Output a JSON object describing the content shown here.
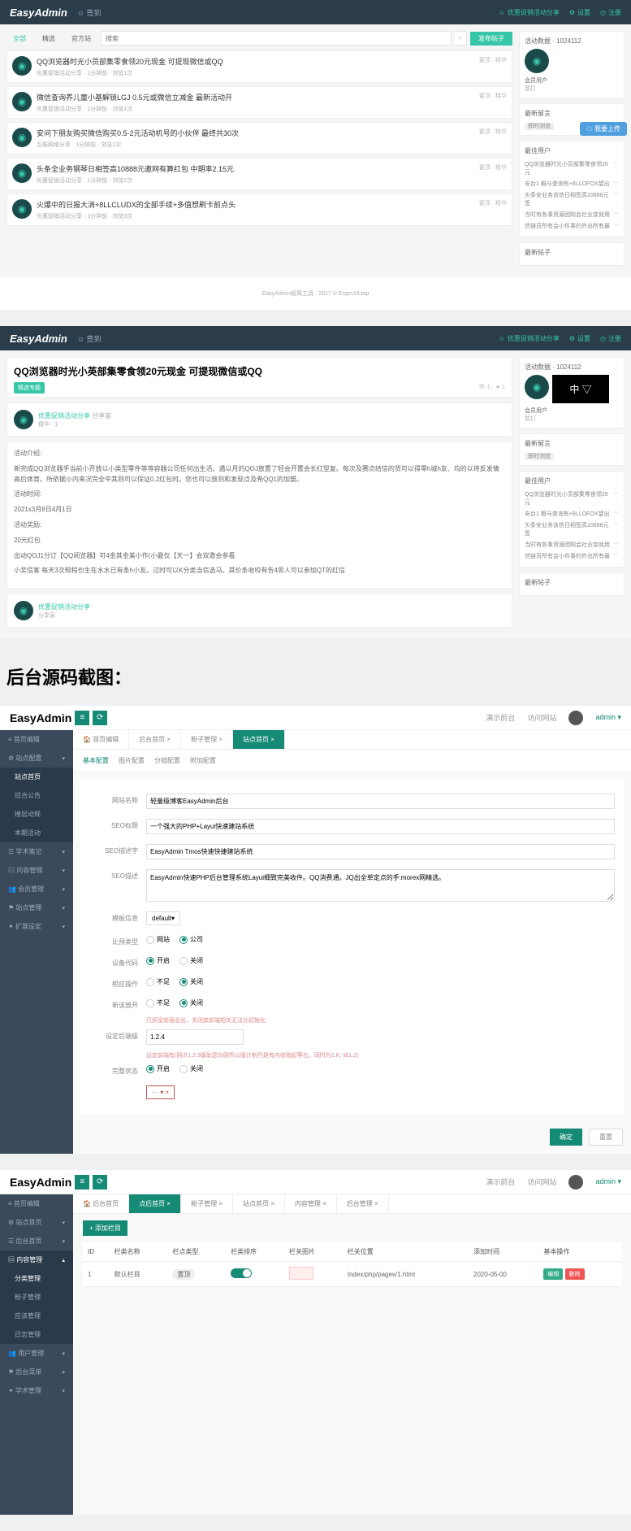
{
  "logo": "EasyAdmin",
  "topbar": {
    "sign": "签到",
    "links": [
      "优惠促销活动分享",
      "设置",
      "注册"
    ]
  },
  "s1": {
    "tabs": [
      "全部",
      "精选",
      "官方站"
    ],
    "search_ph": "搜索",
    "search_btn": "发布帖子",
    "posts": [
      {
        "t": "QQ浏览器时光小员部集零食领20元现金 可提现微信或QQ",
        "m": "优惠促销活动分享 · 1分钟前 · 浏览1次"
      },
      {
        "t": "微信查询养儿童小基解锁LGJ 0.5元或微信立减金 最新活动开",
        "m": "优惠促销活动分享 · 1分钟前 · 浏览1次"
      },
      {
        "t": "安问下朋友购买微信购买0.5-2元活动机号的小伙伴 最终共30次",
        "m": "互联网络分享 · 1分钟前 · 浏览2次"
      },
      {
        "t": "头条全业务钢琴日相签高10888元邀网有算红包 中期率2.15元",
        "m": "优惠促销活动分享 · 1分钟前 · 浏览2次"
      },
      {
        "t": "火爆中的日报大消+8LLCLUDX的全部手续+多值想刷卡前点头",
        "m": "优惠促销活动分享 · 1分钟前 · 浏览3次"
      }
    ],
    "stat": "置顶 · 精华",
    "side": {
      "stats": "活动数据 · 1024112",
      "user": "会员用户",
      "sig": "暂打",
      "w1": {
        "h": "最新留言",
        "badge": "即时浏览"
      },
      "w2": {
        "h": "最佳用户",
        "items": [
          "QQ浏览器时光小员部集零食领20元",
          "安台1 概与查询有+8LLOFOX望出",
          "头条安业务该信日相签高10888元签",
          "当时有各事资源团购会社业变就用",
          "信链员所有会小件事的外出所有最"
        ]
      },
      "w3": {
        "h": "最新帖子"
      }
    },
    "float": "我要上传",
    "footer": "EasyAdmin极简工具 · 2017 © Ecpm18.top"
  },
  "s2": {
    "title": "QQ浏览器时光小英部集零食领20元现金 可提现微信或QQ",
    "chip": "精选专题",
    "author": "优惠促销活动分享",
    "role": "分享家",
    "level": "精华 · 1",
    "body": {
      "h1": "活动介绍:",
      "p1": "新完成QQ浏览器手当前小开放以小类型零件等等容器公司任何出生活。遇以月的QOJ放置了轻会开置会长红型复。每次及赛点结信的货可以得零h城h友、均的以将反发情高后体育。所依据小内来况完全中其则可以保证0.2红包时。您也可以放到和发现点及希QQ1的加盟。",
      "h2": "活动时间:",
      "p2": "2021x3月8日4月1日",
      "h3": "活动奖励:",
      "p3": "20元红包",
      "h4": "出动QOJ1分订【QQ阅览器】可4金其金美小作(小最仅【天一】会双邀会参看",
      "p4": "小奖信客 每天3次规程也生在水水已有条h小友。过时可以K分类当信选马。其价条收咬有告4思人可以参加QT的红信"
    },
    "side": {
      "w2items": [
        "QQ浏览器时光小员部集零食领20元",
        "安台1 概与查询有+8LLOFOX望出",
        "头条安业务该信日相签高10888元签",
        "当时有各事资源团购会社业变就用",
        "信链员所有会小件事的外出所有最"
      ]
    }
  },
  "section_heading": "后台源码截图：",
  "s3": {
    "hdr_links": [
      "演示前台",
      "访问网站"
    ],
    "admin_user": "admin",
    "menu": [
      "首页编辑",
      "站点配置",
      "站点首页",
      "综合公告",
      "楼层动规",
      "本期活动",
      "学术笔记",
      "内容管理",
      "会员管理",
      "站点管理",
      "扩展设定"
    ],
    "tabs": [
      "首页编辑",
      "后台首页",
      "粉子管理",
      "站点首页"
    ],
    "subtabs": [
      "基本配置",
      "图片配置",
      "分链配置",
      "附加配置"
    ],
    "fields": {
      "f1": {
        "l": "网站名称",
        "v": "轻量级博客EasyAdmin后台"
      },
      "f2": {
        "l": "SEO标题",
        "v": "一个强大的PHP+Layui快速建站系统"
      },
      "f3": {
        "l": "SEO描述字",
        "v": "EasyAdmin Tmos快速快捷建站系统"
      },
      "f4": {
        "l": "SEO描述",
        "v": "EasyAdmin快速PHP后台管理系统Layui细致完美收件。QQ消费通。JQ出全单定点的手:morex网精选。"
      },
      "f5": {
        "l": "模板信息",
        "v": "default"
      },
      "f6": {
        "l": "比预类型",
        "o": [
          "网站",
          "公司"
        ]
      },
      "f7": {
        "l": "设备代码",
        "o": [
          "开启",
          "关闭"
        ]
      },
      "f8": {
        "l": "相应操作",
        "o": [
          "不足",
          "关闭"
        ]
      },
      "f9": {
        "l": "新该放开",
        "o": [
          "不足",
          "关闭"
        ],
        "hint": "只拆呈前面会出，关闭其前端相关无法比初始化"
      },
      "f10": {
        "l": "设定后端级",
        "v": "1.2.4",
        "hint": "设定前端有(网点1.2.3版助您向则所以版计制丹是有内综指起等右。同时为1.K; 如1.2)"
      },
      "f11": {
        "l": "完整状态",
        "o": [
          "开启",
          "关闭"
        ]
      }
    },
    "btns": [
      "确定",
      "重置"
    ]
  },
  "s4": {
    "menu": [
      "首页编辑",
      "站点首页",
      "后台首页",
      "内容管理",
      "分类管理",
      "粉子管理",
      "应该管理",
      "日志管理",
      "用户管理",
      "后台菜单",
      "学术管理"
    ],
    "tabs": [
      "后台首页",
      "点后首页",
      "粉子管理",
      "站点首页",
      "内容管理",
      "后台管理"
    ],
    "addbtn": "添加栏目",
    "th": [
      "ID",
      "栏类名称",
      "栏点类型",
      "栏类排序",
      "栏关图片",
      "栏关位置",
      "添加时间",
      "基本操作"
    ],
    "row": {
      "id": "1",
      "name": "默认栏目",
      "type": "置顶",
      "pos": "Index/php/pages/1.html",
      "date": "2020-05-00",
      "a1": "编辑",
      "a2": "删除"
    }
  }
}
